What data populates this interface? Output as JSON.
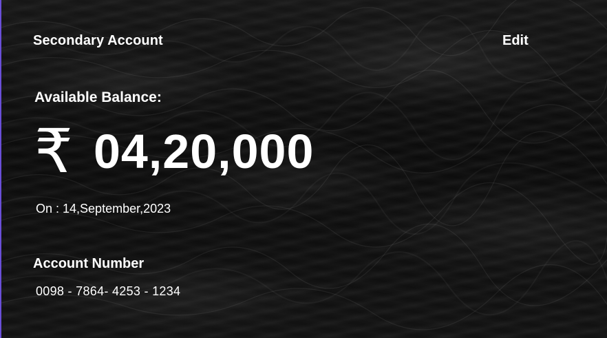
{
  "account": {
    "title": "Secondary Account",
    "edit_label": "Edit"
  },
  "balance": {
    "label": "Available Balance:",
    "currency_symbol": "₹",
    "amount": "04,20,000",
    "date": "On : 14,September,2023"
  },
  "account_number": {
    "label": "Account Number",
    "value": "0098 - 7864- 4253 - 1234"
  },
  "colors": {
    "background": "#0c0c0c",
    "text": "#ffffff",
    "left_border_accent": "#6a4fd8"
  },
  "icons": {
    "currency": "rupee-icon"
  }
}
